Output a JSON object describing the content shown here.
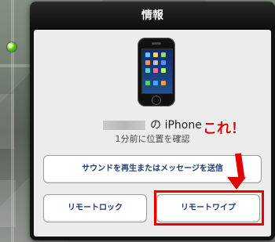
{
  "popover": {
    "title": "情報"
  },
  "device": {
    "name_suffix": "の iPhone",
    "location_status": "1分前に位置を確認"
  },
  "buttons": {
    "play_sound": "サウンドを再生またはメッセージを送信",
    "remote_lock": "リモートロック",
    "remote_wipe": "リモートワイプ"
  },
  "annotation": {
    "text": "これ！"
  },
  "colors": {
    "title_bar": "#111111",
    "content_bg": "#ececec",
    "button_text": "#1d3c7a",
    "annotation_red": "#e60000",
    "pin_green": "#61c11f"
  },
  "icons": {
    "location_pin": "green-location-pin",
    "device": "iphone-icon"
  }
}
